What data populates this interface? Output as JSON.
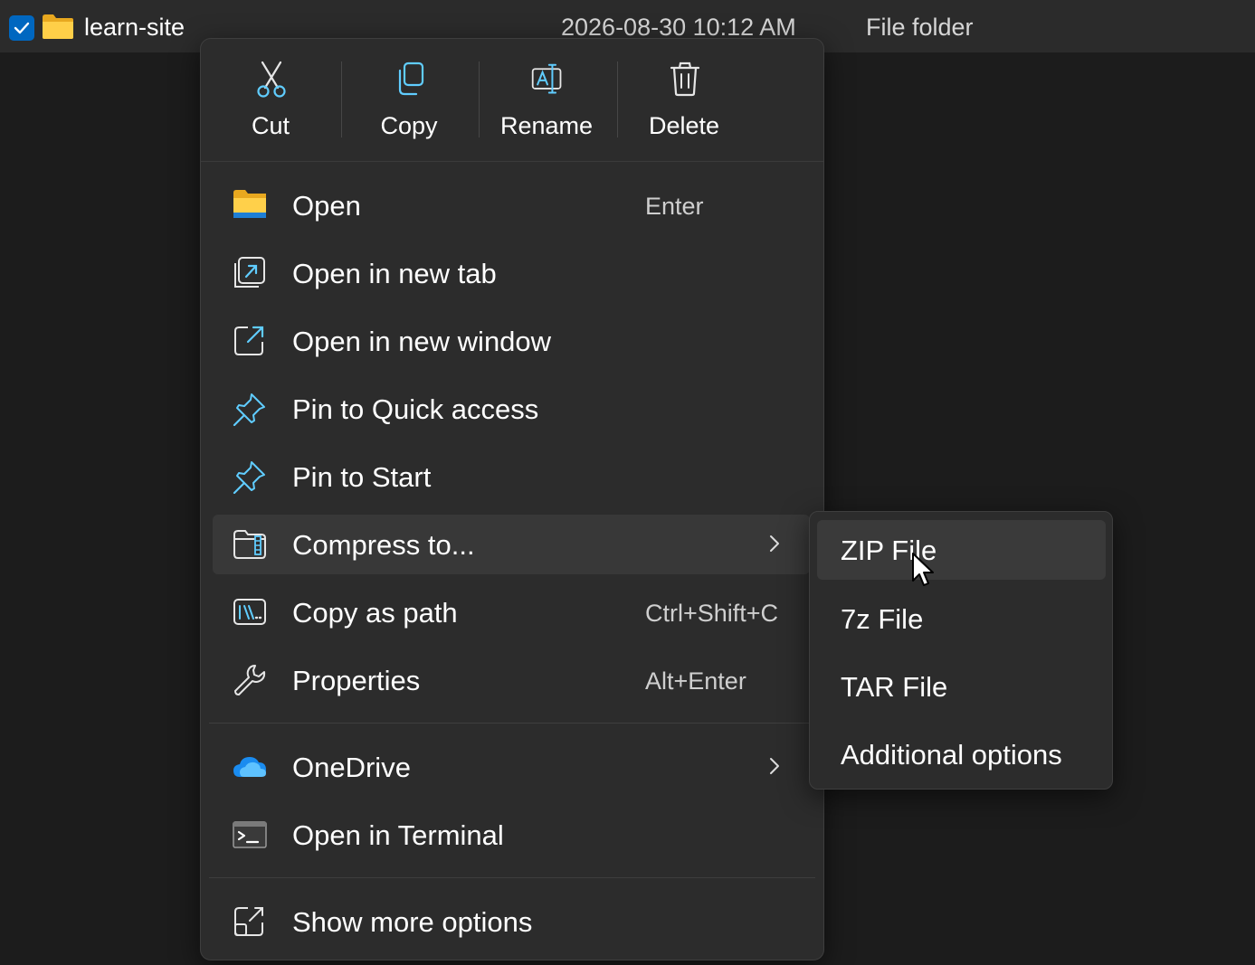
{
  "file_row": {
    "name": "learn-site",
    "date": "2026-08-30 10:12 AM",
    "type": "File folder",
    "checked": true
  },
  "quick_actions": [
    {
      "label": "Cut",
      "icon": "scissors-icon"
    },
    {
      "label": "Copy",
      "icon": "copy-icon"
    },
    {
      "label": "Rename",
      "icon": "rename-icon"
    },
    {
      "label": "Delete",
      "icon": "trash-icon"
    }
  ],
  "menu_items": [
    {
      "label": "Open",
      "accelerator": "Enter",
      "icon": "folder-open-icon"
    },
    {
      "label": "Open in new tab",
      "accelerator": "",
      "icon": "new-tab-icon"
    },
    {
      "label": "Open in new window",
      "accelerator": "",
      "icon": "new-window-icon"
    },
    {
      "label": "Pin to Quick access",
      "accelerator": "",
      "icon": "pin-icon"
    },
    {
      "label": "Pin to Start",
      "accelerator": "",
      "icon": "pin-icon"
    },
    {
      "label": "Compress to...",
      "accelerator": "",
      "icon": "compress-folder-icon",
      "has_submenu": true,
      "highlighted": true
    },
    {
      "label": "Copy as path",
      "accelerator": "Ctrl+Shift+C",
      "icon": "copy-path-icon"
    },
    {
      "label": "Properties",
      "accelerator": "Alt+Enter",
      "icon": "wrench-icon"
    },
    {
      "label": "OneDrive",
      "accelerator": "",
      "icon": "onedrive-cloud-icon",
      "has_submenu": true
    },
    {
      "label": "Open in Terminal",
      "accelerator": "",
      "icon": "terminal-icon"
    },
    {
      "label": "Show more options",
      "accelerator": "",
      "icon": "more-options-icon"
    }
  ],
  "submenu_items": [
    {
      "label": "ZIP File",
      "highlighted": true
    },
    {
      "label": "7z File"
    },
    {
      "label": "TAR File"
    },
    {
      "label": "Additional options"
    }
  ],
  "colors": {
    "accent_blue": "#60cdff",
    "folder_yellow": "#f8c43a",
    "menu_bg": "#2c2c2c",
    "hover_bg": "#383838"
  }
}
